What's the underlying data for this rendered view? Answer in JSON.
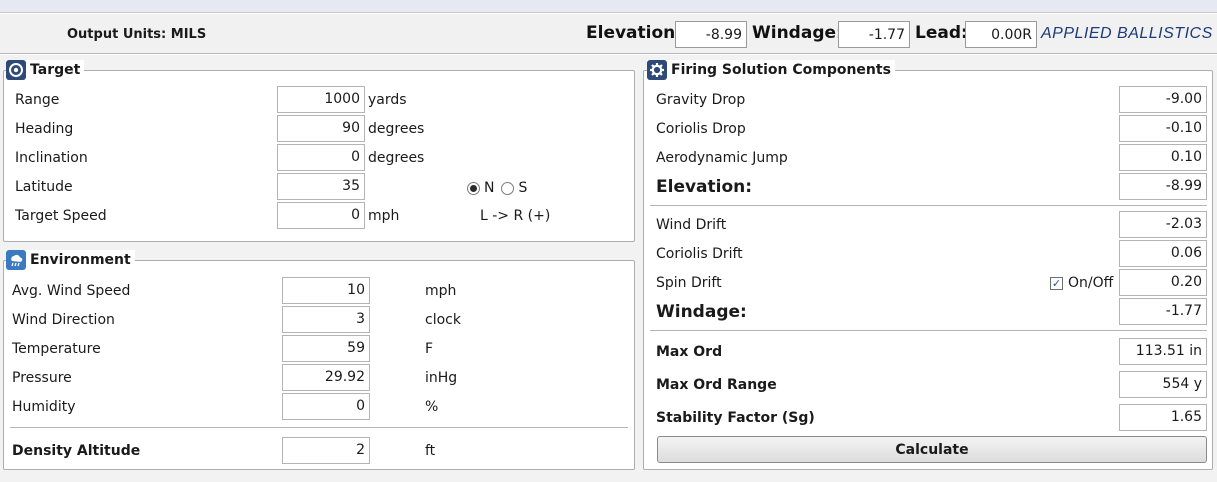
{
  "header": {
    "output_units": "Output Units: MILS",
    "elevation_label": "Elevation:",
    "elevation_value": "-8.99",
    "windage_label": "Windage:",
    "windage_value": "-1.77",
    "lead_label": "Lead:",
    "lead_value": "0.00R",
    "brand": "APPLIED BALLISTICS"
  },
  "target": {
    "title": "Target",
    "icon": "target-icon",
    "range_label": "Range",
    "range_value": "1000",
    "range_unit": "yards",
    "heading_label": "Heading",
    "heading_value": "90",
    "heading_unit": "degrees",
    "inclination_label": "Inclination",
    "inclination_value": "0",
    "inclination_unit": "degrees",
    "latitude_label": "Latitude",
    "latitude_value": "35",
    "hemisphere_n": "N",
    "hemisphere_s": "S",
    "hemisphere_selected": "N",
    "speed_label": "Target Speed",
    "speed_value": "0",
    "speed_unit": "mph",
    "direction_note": "L -> R (+)"
  },
  "environment": {
    "title": "Environment",
    "icon": "weather-icon",
    "wind_speed_label": "Avg. Wind Speed",
    "wind_speed_value": "10",
    "wind_speed_unit": "mph",
    "wind_dir_label": "Wind Direction",
    "wind_dir_value": "3",
    "wind_dir_unit": "clock",
    "temp_label": "Temperature",
    "temp_value": "59",
    "temp_unit": "F",
    "pressure_label": "Pressure",
    "pressure_value": "29.92",
    "pressure_unit": "inHg",
    "humidity_label": "Humidity",
    "humidity_value": "0",
    "humidity_unit": "%",
    "da_label": "Density Altitude",
    "da_value": "2",
    "da_unit": "ft"
  },
  "firing": {
    "title": "Firing Solution Components",
    "icon": "gear-icon",
    "gravity_label": "Gravity Drop",
    "gravity_value": "-9.00",
    "coriolis_drop_label": "Coriolis Drop",
    "coriolis_drop_value": "-0.10",
    "aero_label": "Aerodynamic Jump",
    "aero_value": "0.10",
    "elevation_label": "Elevation:",
    "elevation_value": "-8.99",
    "wind_drift_label": "Wind Drift",
    "wind_drift_value": "-2.03",
    "coriolis_drift_label": "Coriolis Drift",
    "coriolis_drift_value": "0.06",
    "spin_label": "Spin Drift",
    "spin_toggle_label": "On/Off",
    "spin_checked": true,
    "spin_value": "0.20",
    "windage_label": "Windage:",
    "windage_value": "-1.77",
    "max_ord_label": "Max Ord",
    "max_ord_value": "113.51 in",
    "max_ord_range_label": "Max Ord Range",
    "max_ord_range_value": "554 y",
    "stability_label": "Stability Factor (Sg)",
    "stability_value": "1.65",
    "calculate_label": "Calculate"
  },
  "colors": {
    "brand": "#1a3a7a",
    "icon_bg": "#2d4a79"
  }
}
